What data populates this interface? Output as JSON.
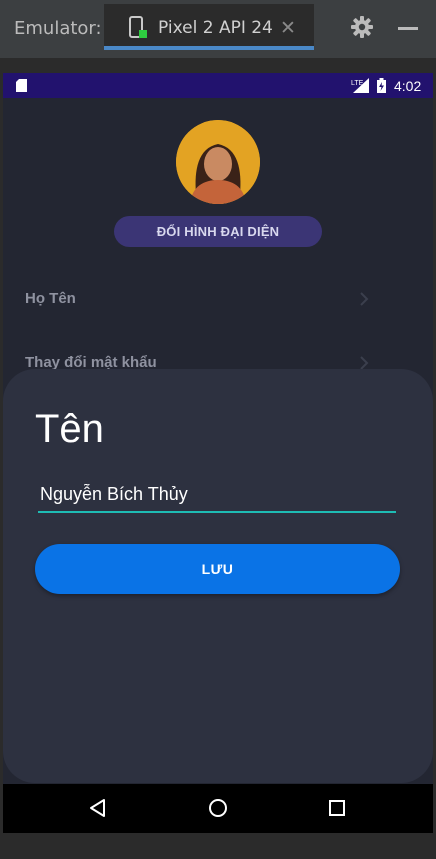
{
  "window": {
    "label": "Emulator:",
    "tab_title": "Pixel 2 API 24",
    "close_glyph": "✕",
    "accent": "#4a88c7"
  },
  "status_bar": {
    "time": "4:02",
    "network": "LTE",
    "background": "#22126e"
  },
  "profile": {
    "change_avatar_label": "ĐỔI HÌNH ĐẠI DIỆN",
    "menu": [
      {
        "label": "Họ Tên",
        "icon": "chevron-right-icon"
      },
      {
        "label": "Thay đổi mật khẩu",
        "icon": "chevron-right-icon"
      }
    ]
  },
  "sheet": {
    "title": "Tên",
    "name_value": "Nguyễn Bích Thủy",
    "save_label": "LƯU",
    "accent": "#0a73e6",
    "input_underline": "#1ebcb4"
  },
  "nav": {
    "back": "back-icon",
    "home": "home-icon",
    "recents": "recents-icon"
  }
}
